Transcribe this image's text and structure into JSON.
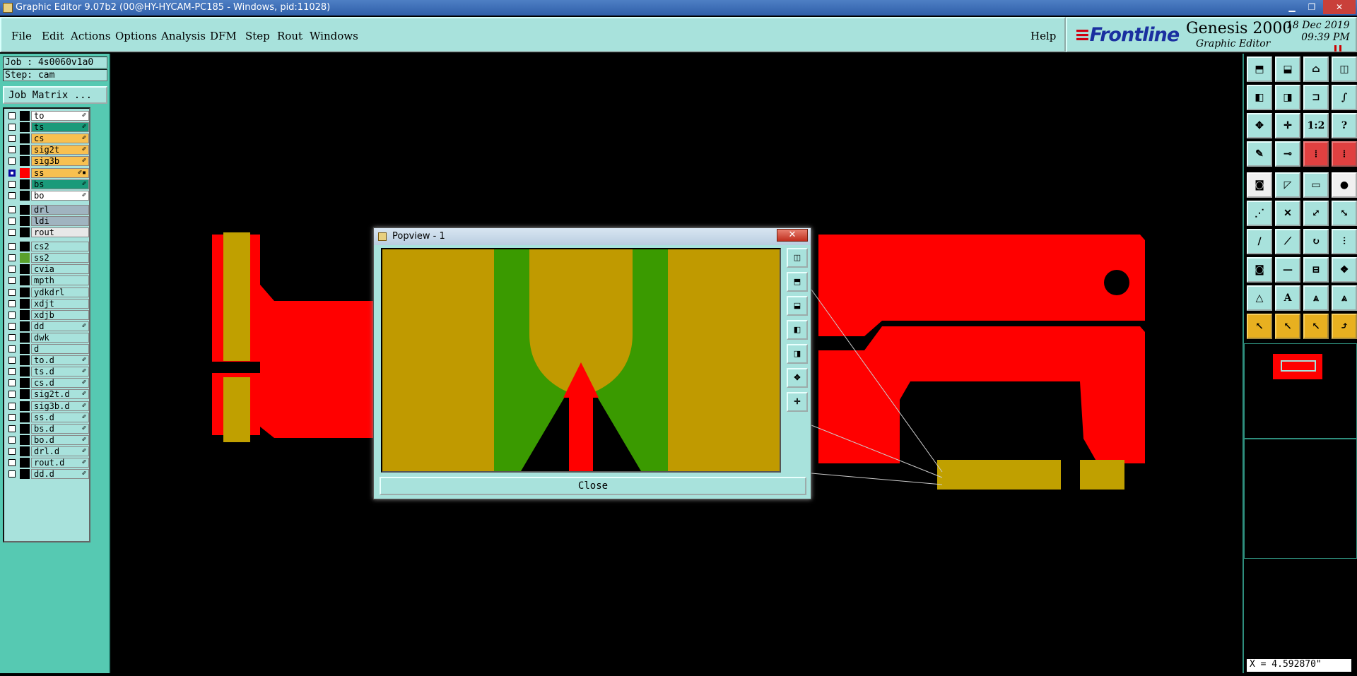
{
  "window": {
    "title": "Graphic Editor 9.07b2 (00@HY-HYCAM-PC185 - Windows, pid:11028)"
  },
  "menu": {
    "items": [
      "File",
      "Edit",
      "Actions",
      "Options",
      "Analysis",
      "DFM",
      "Step",
      "Rout",
      "Windows"
    ],
    "help": "Help"
  },
  "brand": {
    "logo": "Frontline",
    "product": "Genesis 2000",
    "subtitle": "Graphic Editor",
    "date": "18 Dec 2019",
    "time": "09:39 PM"
  },
  "job": {
    "job_line": "Job : 4s0060v1a0",
    "step_line": "Step: cam",
    "matrix_button": "Job Matrix ..."
  },
  "layers": [
    {
      "name": "to",
      "color": "#ffffff",
      "sw": "#000000",
      "mark": "✐"
    },
    {
      "name": "ts",
      "color": "#1a9a7a",
      "sw": "#000000",
      "mark": "✐"
    },
    {
      "name": "cs",
      "color": "#f8c050",
      "sw": "#000000",
      "mark": "✐"
    },
    {
      "name": "sig2t",
      "color": "#f8c050",
      "sw": "#000000",
      "mark": "✐"
    },
    {
      "name": "sig3b",
      "color": "#f8c050",
      "sw": "#000000",
      "mark": "✐"
    },
    {
      "name": "ss",
      "color": "#f8c050",
      "sw": "#ff0000",
      "mark": "✐▪",
      "checked": true
    },
    {
      "name": "bs",
      "color": "#1a9a7a",
      "sw": "#000000",
      "mark": "✐"
    },
    {
      "name": "bo",
      "color": "#ffffff",
      "sw": "#000000",
      "mark": "✐"
    },
    {
      "name": "drl",
      "color": "#a0b4c0",
      "sw": "#000000",
      "mark": ""
    },
    {
      "name": "ldi",
      "color": "#a0b4c0",
      "sw": "#000000",
      "mark": ""
    },
    {
      "name": "rout",
      "color": "#e8e8e8",
      "sw": "#000000",
      "mark": ""
    },
    {
      "name": "cs2",
      "color": "#a8e2dc",
      "sw": "#000000",
      "mark": ""
    },
    {
      "name": "ss2",
      "color": "#a8e2dc",
      "sw": "#5aa02c",
      "mark": ""
    },
    {
      "name": "cvia",
      "color": "#a8e2dc",
      "sw": "#000000",
      "mark": ""
    },
    {
      "name": "mpth",
      "color": "#a8e2dc",
      "sw": "#000000",
      "mark": ""
    },
    {
      "name": "ydkdrl",
      "color": "#a8e2dc",
      "sw": "#000000",
      "mark": ""
    },
    {
      "name": "xdjt",
      "color": "#a8e2dc",
      "sw": "#000000",
      "mark": ""
    },
    {
      "name": "xdjb",
      "color": "#a8e2dc",
      "sw": "#000000",
      "mark": ""
    },
    {
      "name": "dd",
      "color": "#a8e2dc",
      "sw": "#000000",
      "mark": "✐"
    },
    {
      "name": "dwk",
      "color": "#a8e2dc",
      "sw": "#000000",
      "mark": ""
    },
    {
      "name": "d",
      "color": "#a8e2dc",
      "sw": "#000000",
      "mark": ""
    },
    {
      "name": "to.d",
      "color": "#a8e2dc",
      "sw": "#000000",
      "mark": "✐"
    },
    {
      "name": "ts.d",
      "color": "#a8e2dc",
      "sw": "#000000",
      "mark": "✐"
    },
    {
      "name": "cs.d",
      "color": "#a8e2dc",
      "sw": "#000000",
      "mark": "✐"
    },
    {
      "name": "sig2t.d",
      "color": "#a8e2dc",
      "sw": "#000000",
      "mark": "✐"
    },
    {
      "name": "sig3b.d",
      "color": "#a8e2dc",
      "sw": "#000000",
      "mark": "✐"
    },
    {
      "name": "ss.d",
      "color": "#a8e2dc",
      "sw": "#000000",
      "mark": "✐"
    },
    {
      "name": "bs.d",
      "color": "#a8e2dc",
      "sw": "#000000",
      "mark": "✐"
    },
    {
      "name": "bo.d",
      "color": "#a8e2dc",
      "sw": "#000000",
      "mark": "✐"
    },
    {
      "name": "drl.d",
      "color": "#a8e2dc",
      "sw": "#000000",
      "mark": "✐"
    },
    {
      "name": "rout.d",
      "color": "#a8e2dc",
      "sw": "#000000",
      "mark": "✐"
    },
    {
      "name": "dd.d",
      "color": "#a8e2dc",
      "sw": "#000000",
      "mark": "✐"
    }
  ],
  "popview": {
    "title": "Popview - 1",
    "close_label": "Close"
  },
  "toolbar": {
    "buttons": [
      {
        "glyph": "⬒",
        "name": "open-icon",
        "cls": ""
      },
      {
        "glyph": "⬓",
        "name": "save-icon",
        "cls": ""
      },
      {
        "glyph": "⌂",
        "name": "home-icon",
        "cls": ""
      },
      {
        "glyph": "◫",
        "name": "layout-icon",
        "cls": ""
      },
      {
        "glyph": "◧",
        "name": "zoom-left-icon",
        "cls": ""
      },
      {
        "glyph": "◨",
        "name": "zoom-right-icon",
        "cls": ""
      },
      {
        "glyph": "⊐",
        "name": "pan-icon",
        "cls": ""
      },
      {
        "glyph": "∫",
        "name": "snap-icon",
        "cls": ""
      },
      {
        "glyph": "✥",
        "name": "zoom-fit-icon",
        "cls": ""
      },
      {
        "glyph": "✛",
        "name": "zoom-area-icon",
        "cls": ""
      },
      {
        "glyph": "1:2",
        "name": "scale-icon",
        "cls": ""
      },
      {
        "glyph": "?",
        "name": "help-icon",
        "cls": ""
      },
      {
        "glyph": "✎",
        "name": "measure-icon",
        "cls": ""
      },
      {
        "glyph": "⊸",
        "name": "probe-icon",
        "cls": ""
      },
      {
        "glyph": "⁞",
        "name": "layers-up-icon",
        "cls": "r"
      },
      {
        "glyph": "⁞",
        "name": "layers-down-icon",
        "cls": "r"
      },
      {
        "glyph": "◙",
        "name": "pad-icon",
        "cls": "b"
      },
      {
        "glyph": "◸",
        "name": "rect-icon",
        "cls": ""
      },
      {
        "glyph": "▭",
        "name": "ruler-icon",
        "cls": ""
      },
      {
        "glyph": "●",
        "name": "circle-icon",
        "cls": "b"
      },
      {
        "glyph": "⋰",
        "name": "net-icon",
        "cls": ""
      },
      {
        "glyph": "✕",
        "name": "cross-icon",
        "cls": ""
      },
      {
        "glyph": "⤢",
        "name": "move-icon",
        "cls": ""
      },
      {
        "glyph": "⤡",
        "name": "copy-icon",
        "cls": ""
      },
      {
        "glyph": "∕",
        "name": "line-icon",
        "cls": ""
      },
      {
        "glyph": "⟋",
        "name": "line2-icon",
        "cls": ""
      },
      {
        "glyph": "↻",
        "name": "rotate-icon",
        "cls": ""
      },
      {
        "glyph": "⫶",
        "name": "mirror-icon",
        "cls": ""
      },
      {
        "glyph": "◙",
        "name": "feature-icon",
        "cls": ""
      },
      {
        "glyph": "—",
        "name": "hline-icon",
        "cls": ""
      },
      {
        "glyph": "⊟",
        "name": "group-icon",
        "cls": ""
      },
      {
        "glyph": "❖",
        "name": "pattern-icon",
        "cls": ""
      },
      {
        "glyph": "△",
        "name": "text-a-icon",
        "cls": ""
      },
      {
        "glyph": "A",
        "name": "text-b-icon",
        "cls": ""
      },
      {
        "glyph": "⩓",
        "name": "text-c-icon",
        "cls": ""
      },
      {
        "glyph": "⩓",
        "name": "text-d-icon",
        "cls": ""
      },
      {
        "glyph": "↖",
        "name": "select-icon",
        "cls": "y"
      },
      {
        "glyph": "↖",
        "name": "select2-icon",
        "cls": "y"
      },
      {
        "glyph": "↖",
        "name": "select3-icon",
        "cls": "y"
      },
      {
        "glyph": "⤴",
        "name": "route-icon",
        "cls": "y"
      }
    ]
  },
  "coord": {
    "x": "X = 4.592870\""
  }
}
